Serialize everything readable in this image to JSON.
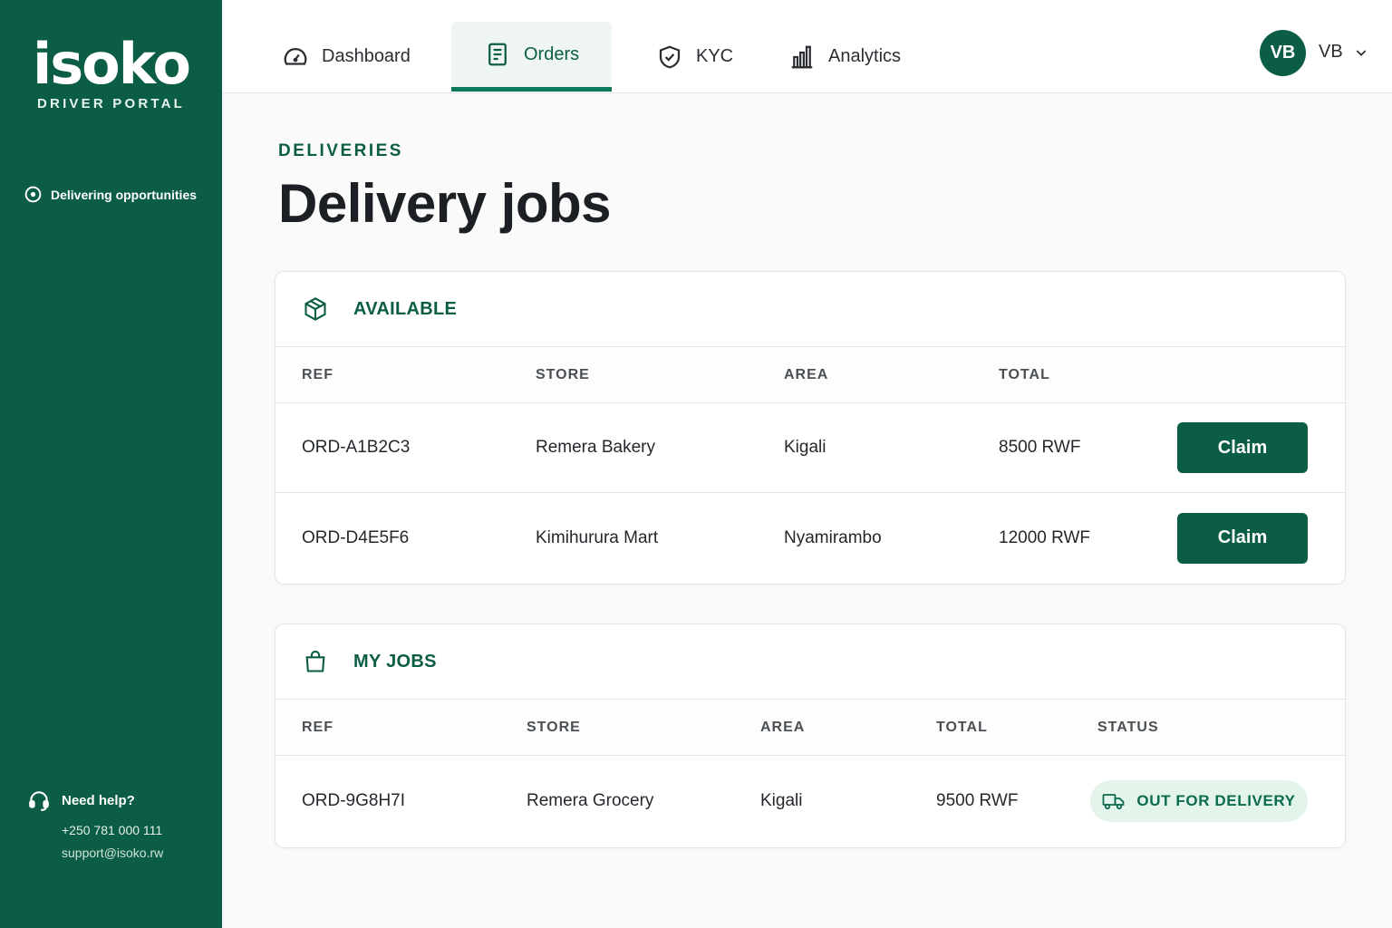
{
  "brand": {
    "name": "isoko",
    "subtitle": "DRIVER PORTAL",
    "tagline": "Delivering opportunities"
  },
  "support": {
    "title": "Need help?",
    "phone": "+250 781 000 111",
    "email": "support@isoko.rw"
  },
  "nav": {
    "items": [
      {
        "label": "Dashboard",
        "icon": "gauge-icon"
      },
      {
        "label": "Orders",
        "icon": "document-icon",
        "active": true
      },
      {
        "label": "KYC",
        "icon": "shield-check-icon"
      },
      {
        "label": "Analytics",
        "icon": "bar-chart-icon"
      }
    ]
  },
  "user": {
    "initials": "VB",
    "name": "VB"
  },
  "page": {
    "eyebrow": "DELIVERIES",
    "title": "Delivery jobs"
  },
  "available": {
    "title": "AVAILABLE",
    "columns": [
      "REF",
      "STORE",
      "AREA",
      "TOTAL"
    ],
    "rows": [
      {
        "ref": "ORD-A1B2C3",
        "store": "Remera Bakery",
        "area": "Kigali",
        "total": "8500 RWF",
        "action": "Claim"
      },
      {
        "ref": "ORD-D4E5F6",
        "store": "Kimihurura Mart",
        "area": "Nyamirambo",
        "total": "12000 RWF",
        "action": "Claim"
      }
    ]
  },
  "my_jobs": {
    "title": "MY JOBS",
    "columns": [
      "REF",
      "STORE",
      "AREA",
      "TOTAL",
      "STATUS"
    ],
    "rows": [
      {
        "ref": "ORD-9G8H7I",
        "store": "Remera Grocery",
        "area": "Kigali",
        "total": "9500 RWF",
        "status": "OUT FOR DELIVERY"
      }
    ]
  },
  "colors": {
    "brand": "#0b5d45",
    "badge_bg": "#e3f4ea",
    "page_bg": "#fafafa"
  }
}
